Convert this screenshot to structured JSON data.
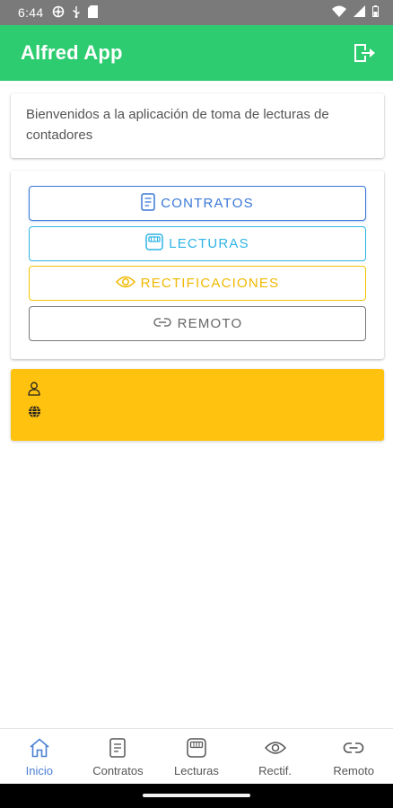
{
  "status_bar": {
    "time": "6:44",
    "left_icons": [
      "settings-wheel-icon",
      "usb-icon",
      "sd-card-icon"
    ],
    "right_icons": [
      "wifi-icon",
      "signal-icon",
      "battery-icon"
    ]
  },
  "app_bar": {
    "title": "Alfred App",
    "action_icon": "logout-icon",
    "color": "#2ecc71"
  },
  "welcome": {
    "text": "Bienvenidos a la aplicación de toma de lecturas de contadores"
  },
  "buttons": [
    {
      "label": "CONTRATOS",
      "icon": "document-icon",
      "color": "#3a78d8"
    },
    {
      "label": "LECTURAS",
      "icon": "meter-icon",
      "color": "#2fb4e6"
    },
    {
      "label": "RECTIFICACIONES",
      "icon": "eye-icon",
      "color": "#f0b800"
    },
    {
      "label": "REMOTO",
      "icon": "link-icon",
      "color": "#666666"
    }
  ],
  "info_card": {
    "color": "#fec20f",
    "user_value": "",
    "web_value": "",
    "icons": [
      "user-icon",
      "globe-icon"
    ]
  },
  "bottom_nav": {
    "items": [
      {
        "label": "Inicio",
        "icon": "home-icon",
        "active": true
      },
      {
        "label": "Contratos",
        "icon": "document-icon",
        "active": false
      },
      {
        "label": "Lecturas",
        "icon": "meter-icon",
        "active": false
      },
      {
        "label": "Rectif.",
        "icon": "eye-icon",
        "active": false
      },
      {
        "label": "Remoto",
        "icon": "link-icon",
        "active": false
      }
    ],
    "active_color": "#4a7fd4"
  }
}
